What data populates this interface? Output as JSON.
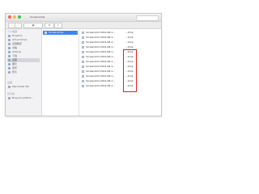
{
  "window": {
    "title": "Screenshots",
    "search_glyph": "⌕"
  },
  "toolbar": {
    "buttons": [
      "‹",
      "›",
      "▦",
      "⚙",
      "⇪"
    ]
  },
  "sidebar": {
    "favorites_label": "个人收藏",
    "items": [
      {
        "label": "Dropbox",
        "icon": "dropbox-icon"
      },
      {
        "label": "iCloud Drive",
        "icon": "cloud-icon"
      },
      {
        "label": "应用程序",
        "icon": "applications-icon"
      },
      {
        "label": "文稿",
        "icon": "documents-icon"
      },
      {
        "label": "AirDrop",
        "icon": "airdrop-icon"
      },
      {
        "label": "下载",
        "icon": "downloads-icon"
      },
      {
        "label": "桌面",
        "icon": "desktop-icon"
      },
      {
        "label": "图片",
        "icon": "pictures-icon"
      },
      {
        "label": "音乐",
        "icon": "music-icon"
      },
      {
        "label": "影片",
        "icon": "movies-icon"
      }
    ],
    "devices_label": "设备",
    "devices": [
      {
        "label": "Macintosh HD",
        "icon": "disk-icon"
      }
    ],
    "shared_label": "共享的",
    "shared": [
      {
        "label": "Boqun's AirPort...",
        "icon": "network-icon"
      }
    ]
  },
  "main": {
    "selected_folder": "Screenshots",
    "files": [
      {
        "name": "Screenshot 2014-08-1...",
        "type": "...bmp"
      },
      {
        "name": "Screenshot 2014-08-1...",
        "type": "...bmp"
      },
      {
        "name": "Screenshot 2014-08-1...",
        "type": "...bmp"
      },
      {
        "name": "Screenshot 2014-08-1...",
        "type": "...bmp"
      },
      {
        "name": "Screenshot 2014-08-1...",
        "type": "...bmp"
      },
      {
        "name": "Screenshot 2014-08-1...",
        "type": "...bmp"
      },
      {
        "name": "Screenshot 2014-08-1...",
        "type": "...bmp"
      },
      {
        "name": "Screenshot 2014-08-1...",
        "type": "...bmp"
      },
      {
        "name": "Screenshot 2014-08-1...",
        "type": "...bmp"
      },
      {
        "name": "Screenshot 2014-08-1...",
        "type": "...bmp"
      },
      {
        "name": "Screenshot 2014-08-1...",
        "type": "...bmp"
      },
      {
        "name": "Screenshot 2014-08-1...",
        "type": "...bmp"
      }
    ]
  },
  "colors": {
    "selection": "#3f82f2",
    "highlight_box": "#e02020",
    "sidebar_bg": "#f2f2f5"
  }
}
